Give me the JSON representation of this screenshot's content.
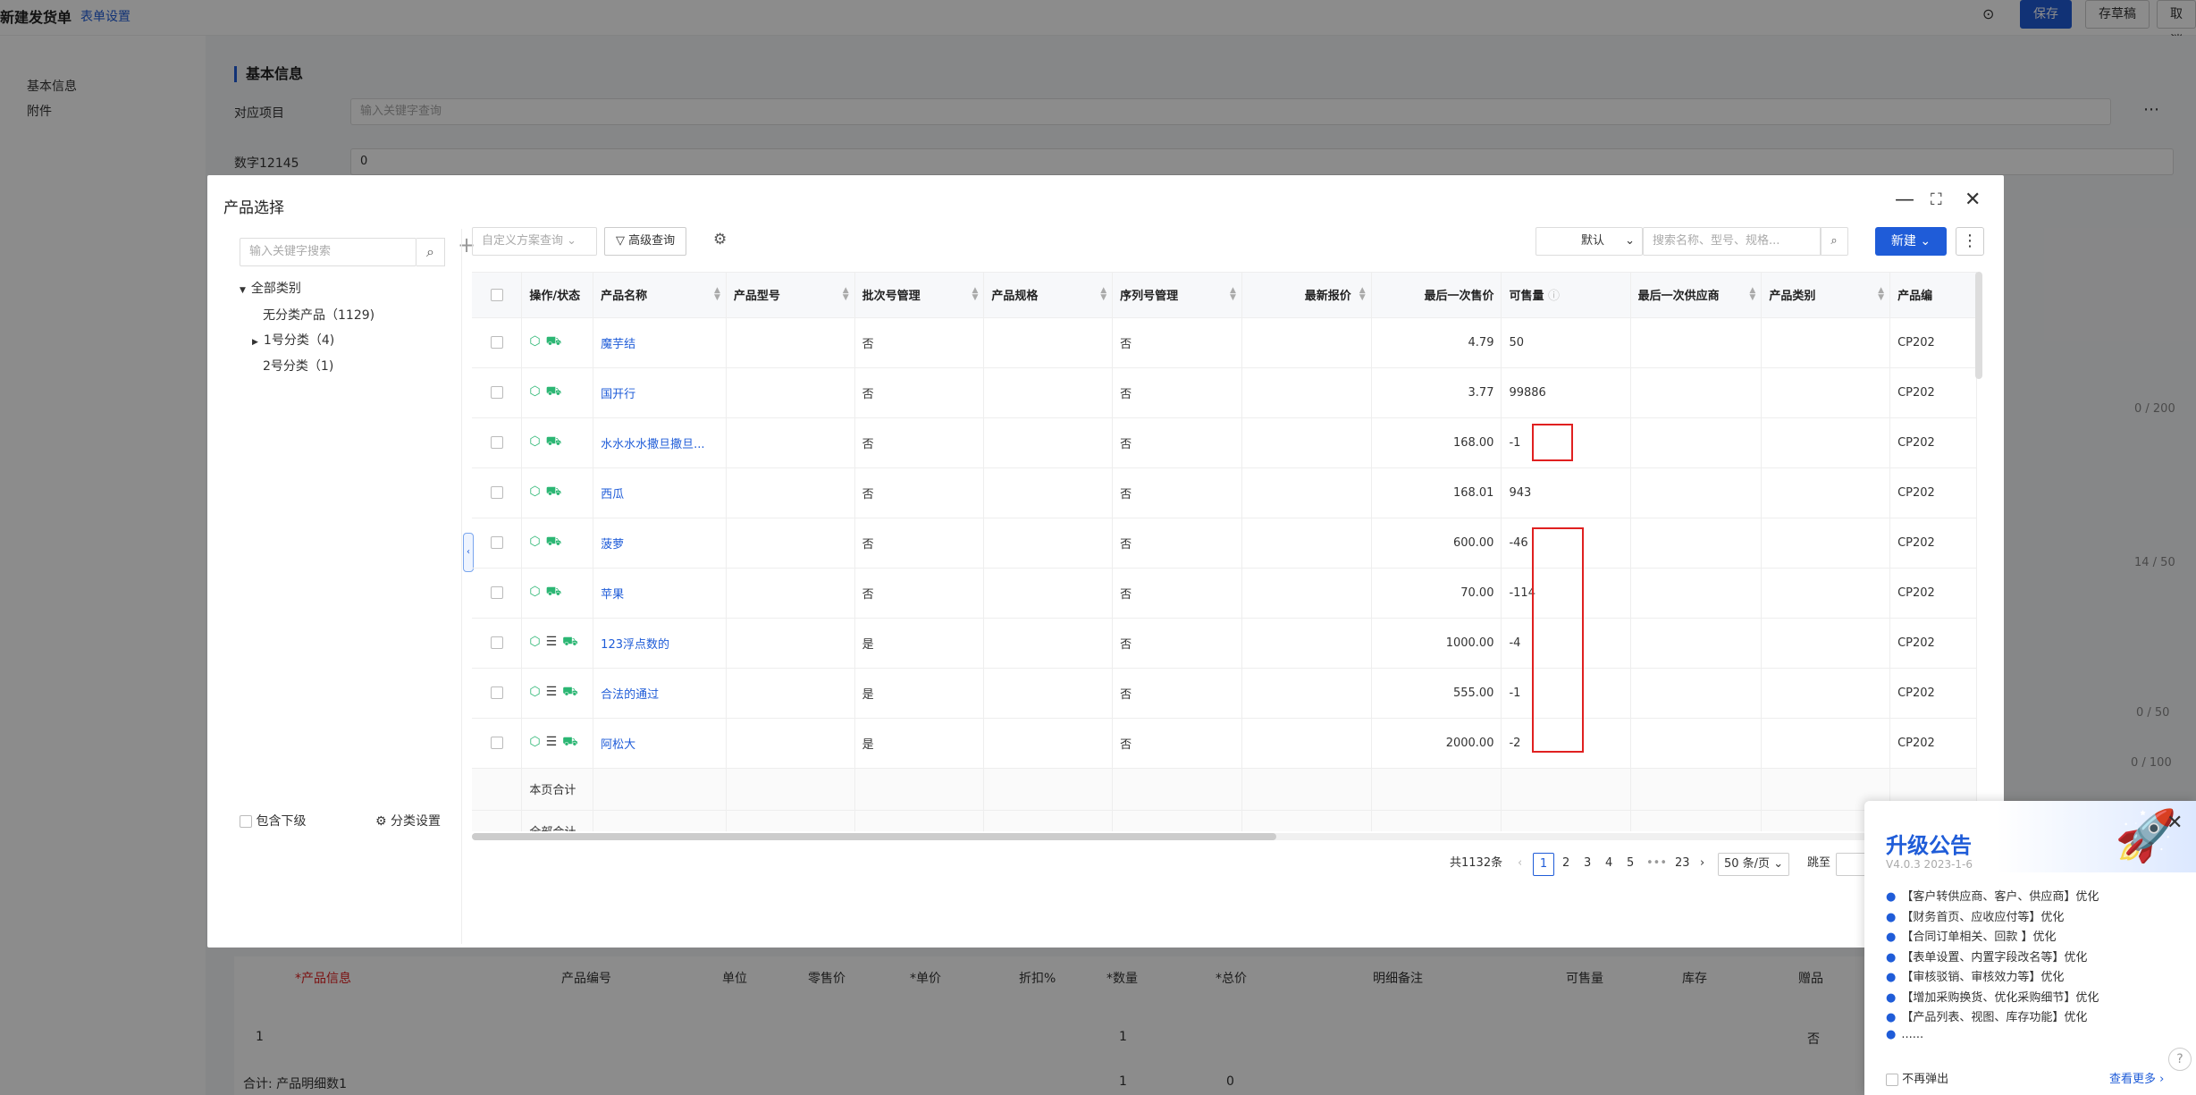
{
  "page": {
    "title": "新建发货单",
    "form_settings": "表单设置",
    "buttons": {
      "save": "保存",
      "draft": "存草稿",
      "cancel": "取消"
    },
    "sidenav": [
      "基本信息",
      "附件"
    ],
    "section_title": "基本信息",
    "fields": [
      {
        "label": "对应项目",
        "placeholder": "输入关键字查询"
      },
      {
        "label": "数字12145",
        "value": "0"
      }
    ],
    "counters": [
      "0 / 200",
      "14 / 50",
      "0 / 50",
      "0 / 100"
    ],
    "grid_headers": [
      "*产品信息",
      "产品编号",
      "单位",
      "零售价",
      "*单价",
      "折扣%",
      "*数量",
      "*总价",
      "明细备注",
      "可售量",
      "库存",
      "赠品"
    ],
    "grid_row": {
      "index": "1",
      "qty": "1",
      "gift": "否"
    },
    "grid_total": {
      "label": "合计: 产品明细数1",
      "qty": "1",
      "total": "0"
    }
  },
  "modal": {
    "title": "产品选择",
    "tree": {
      "search_placeholder": "输入关键字搜索",
      "root": "全部类别",
      "items": [
        "无分类产品（1129)",
        "1号分类（4)",
        "2号分类（1)"
      ],
      "include_sub": "包含下级",
      "category_settings": "分类设置"
    },
    "toolbar": {
      "custom_query": "自定义方案查询",
      "advanced_query": "高级查询",
      "default_sort": "默认",
      "search_placeholder": "搜索名称、型号、规格...",
      "new_button": "新建"
    },
    "table": {
      "headers": [
        "操作/状态",
        "产品名称",
        "产品型号",
        "批次号管理",
        "产品规格",
        "序列号管理",
        "最新报价",
        "最后一次售价",
        "可售量",
        "最后一次供应商",
        "产品类别",
        "产品编"
      ],
      "rows": [
        {
          "name": "魔芋结",
          "batch": "否",
          "serial": "否",
          "last_price": "4.79",
          "available": "50",
          "code": "CP202"
        },
        {
          "name": "国开行",
          "batch": "否",
          "serial": "否",
          "last_price": "3.77",
          "available": "99886",
          "code": "CP202"
        },
        {
          "name": "水水水水撒旦撒旦...",
          "batch": "否",
          "serial": "否",
          "last_price": "168.00",
          "available": "-1",
          "code": "CP202"
        },
        {
          "name": "西瓜",
          "batch": "否",
          "serial": "否",
          "last_price": "168.01",
          "available": "943",
          "code": "CP202"
        },
        {
          "name": "菠萝",
          "batch": "否",
          "serial": "否",
          "last_price": "600.00",
          "available": "-46",
          "code": "CP202"
        },
        {
          "name": "苹果",
          "batch": "否",
          "serial": "否",
          "last_price": "70.00",
          "available": "-114",
          "code": "CP202"
        },
        {
          "name": "123浮点数的",
          "batch": "是",
          "serial": "否",
          "last_price": "1000.00",
          "available": "-4",
          "code": "CP202"
        },
        {
          "name": "合法的通过",
          "batch": "是",
          "serial": "否",
          "last_price": "555.00",
          "available": "-1",
          "code": "CP202"
        },
        {
          "name": "阿松大",
          "batch": "是",
          "serial": "否",
          "last_price": "2000.00",
          "available": "-2",
          "code": "CP202"
        }
      ],
      "page_total": "本页合计",
      "all_total": "全部合计"
    },
    "pagination": {
      "total": "共1132条",
      "pages": [
        "1",
        "2",
        "3",
        "4",
        "5",
        "•••",
        "23"
      ],
      "size": "50 条/页",
      "jump": "跳至"
    }
  },
  "notice": {
    "title": "升级公告",
    "version": "V4.0.3 2023-1-6",
    "items": [
      "【客户转供应商、客户、供应商】优化",
      "【财务首页、应收应付等】优化",
      "【合同订单相关、回款 】优化",
      "【表单设置、内置字段改名等】优化",
      "【审核驳销、审核效力等】优化",
      "【增加采购换货、优化采购细节】优化",
      "【产品列表、视图、库存功能】优化",
      "......"
    ],
    "no_popup": "不再弹出",
    "see_more": "查看更多"
  },
  "colors": {
    "accent": "#1f5cd8",
    "highlight": "#e02020",
    "icon_green": "#2bb673"
  }
}
